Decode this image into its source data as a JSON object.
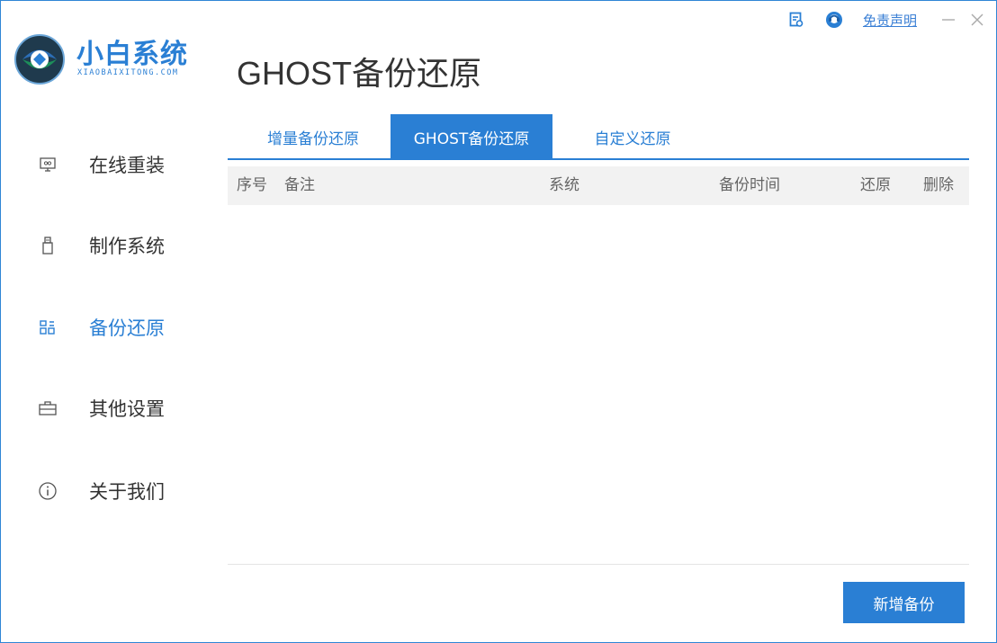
{
  "logo": {
    "title": "小白系统",
    "subtitle": "XIAOBAIXITONG.COM"
  },
  "page_title": "GHOST备份还原",
  "top_controls": {
    "feedback_icon": "feedback-icon",
    "support_icon": "support-icon",
    "disclaimer": "免责声明",
    "minimize": "—",
    "close": "✕"
  },
  "sidebar": {
    "items": [
      {
        "label": "在线重装",
        "icon": "monitor-icon",
        "active": false
      },
      {
        "label": "制作系统",
        "icon": "usb-icon",
        "active": false
      },
      {
        "label": "备份还原",
        "icon": "backup-icon",
        "active": true
      },
      {
        "label": "其他设置",
        "icon": "toolbox-icon",
        "active": false
      },
      {
        "label": "关于我们",
        "icon": "info-icon",
        "active": false
      }
    ]
  },
  "tabs": [
    {
      "label": "增量备份还原",
      "active": false
    },
    {
      "label": "GHOST备份还原",
      "active": true
    },
    {
      "label": "自定义还原",
      "active": false
    }
  ],
  "table": {
    "columns": [
      "序号",
      "备注",
      "系统",
      "备份时间",
      "还原",
      "删除"
    ],
    "rows": []
  },
  "actions": {
    "new_backup": "新增备份"
  },
  "colors": {
    "accent": "#2a7fd4",
    "header_bg": "#f2f2f2",
    "text": "#333333"
  }
}
